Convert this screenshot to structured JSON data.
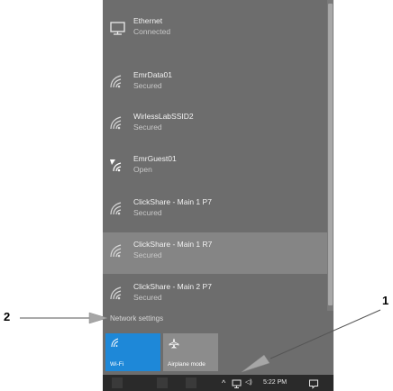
{
  "networks": [
    {
      "name": "Ethernet",
      "status": "Connected",
      "icon": "ethernet-icon"
    },
    {
      "name": "EmrData01",
      "status": "Secured",
      "icon": "wifi-icon"
    },
    {
      "name": "WirlessLabSSID2",
      "status": "Secured",
      "icon": "wifi-icon"
    },
    {
      "name": "EmrGuest01",
      "status": "Open",
      "icon": "wifi-open-icon"
    },
    {
      "name": "ClickShare - Main 1 P7",
      "status": "Secured",
      "icon": "wifi-icon"
    },
    {
      "name": "ClickShare - Main 1 R7",
      "status": "Secured",
      "icon": "wifi-icon"
    },
    {
      "name": "ClickShare - Main 2 P7",
      "status": "Secured",
      "icon": "wifi-icon"
    }
  ],
  "network_settings_label": "Network settings",
  "quick_actions": {
    "wifi_label": "Wi-Fi",
    "airplane_label": "Airplane mode"
  },
  "taskbar": {
    "time": "5:22 PM",
    "chevron": "^",
    "volume": "◁)"
  },
  "annotations": {
    "label_1": "1",
    "label_2": "2"
  },
  "colors": {
    "panel": "#6d6d6d",
    "accent": "#1e88d8"
  }
}
